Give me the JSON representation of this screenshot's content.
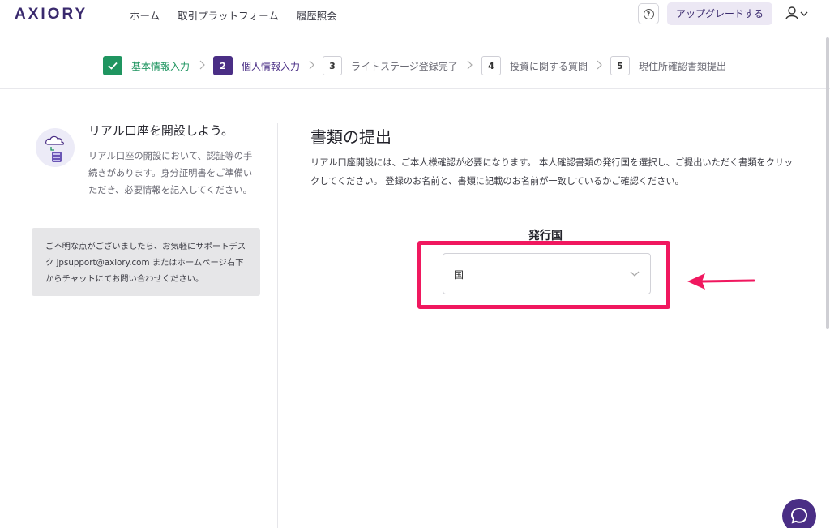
{
  "header": {
    "logo": "AXIORY",
    "nav": [
      "ホーム",
      "取引プラットフォーム",
      "履歴照会"
    ],
    "help_icon": "question-circle-icon",
    "upgrade_label": "アップグレードする",
    "user_icon": "user-icon"
  },
  "stepper": {
    "steps": [
      {
        "number": "",
        "label": "基本情報入力",
        "state": "done"
      },
      {
        "number": "2",
        "label": "個人情報入力",
        "state": "active"
      },
      {
        "number": "3",
        "label": "ライトステージ登録完了",
        "state": "pending"
      },
      {
        "number": "4",
        "label": "投資に関する質問",
        "state": "pending"
      },
      {
        "number": "5",
        "label": "現住所確認書類提出",
        "state": "pending"
      }
    ]
  },
  "sidebar": {
    "title": "リアル口座を開設しよう。",
    "description": "リアル口座の開設において、認証等の手続きがあります。身分証明書をご準備いただき、必要情報を記入してください。",
    "support_text": "ご不明な点がございましたら、お気軽にサポートデスク jpsupport@axiory.com またはホームページ右下からチャットにてお問い合わせください。"
  },
  "main": {
    "title": "書類の提出",
    "description": "リアル口座開設には、ご本人様確認が必要になります。 本人確認書類の発行国を選択し、ご提出いただく書類をクリックしてください。 登録のお名前と、書類に記載のお名前が一致しているかご確認ください。",
    "field_label": "発行国",
    "select_value": "国"
  },
  "colors": {
    "brand": "#4a2e85",
    "done": "#1f9560",
    "highlight": "#f0185f"
  }
}
